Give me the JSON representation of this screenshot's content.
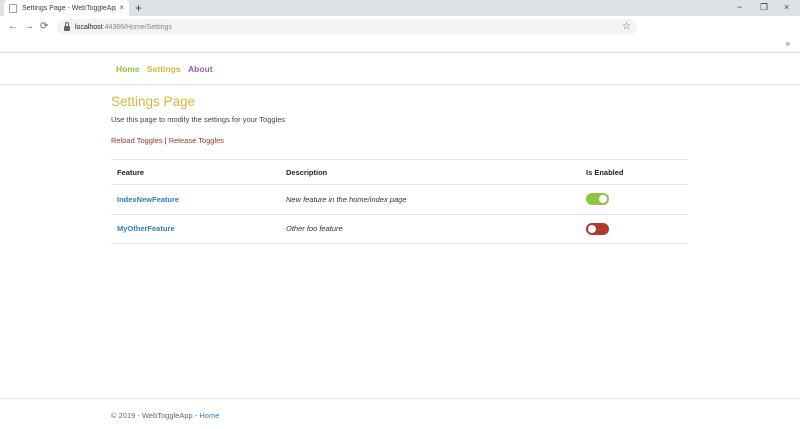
{
  "browser": {
    "tab_title": "Settings Page - WebToggleApp",
    "tab_close_glyph": "×",
    "new_tab_glyph": "+",
    "url_host": "localhost",
    "url_path": ":44366/Home/Settings",
    "window_controls": {
      "minimize": "−",
      "maximize": "❐",
      "close": "×"
    },
    "nav": {
      "back": "←",
      "forward": "→",
      "reload": "⟳"
    },
    "bookmark_star": "☆",
    "bookmarks_more": "»"
  },
  "nav": {
    "items": [
      {
        "label": "Home",
        "color": "#8cc63f"
      },
      {
        "label": "Settings",
        "color": "#d4b73a"
      },
      {
        "label": "About",
        "color": "#9b59b6"
      }
    ]
  },
  "page": {
    "title": "Settings Page",
    "description": "Use this page to modify the settings for your Toggles",
    "reload_link": "Reload Toggles",
    "separator": "|",
    "release_link": "Release Toggles"
  },
  "table": {
    "headers": [
      "Feature",
      "Description",
      "Is Enabled"
    ],
    "rows": [
      {
        "feature": "IndexNewFeature",
        "description": "New feature in the home/index page",
        "enabled": true
      },
      {
        "feature": "MyOtherFeature",
        "description": "Other foo feature",
        "enabled": false
      }
    ]
  },
  "colors": {
    "toggle_on": "#8cc63f",
    "toggle_off": "#b03a2e"
  },
  "footer": {
    "text": "© 2019 - WebToggleApp - ",
    "link": "Home"
  }
}
